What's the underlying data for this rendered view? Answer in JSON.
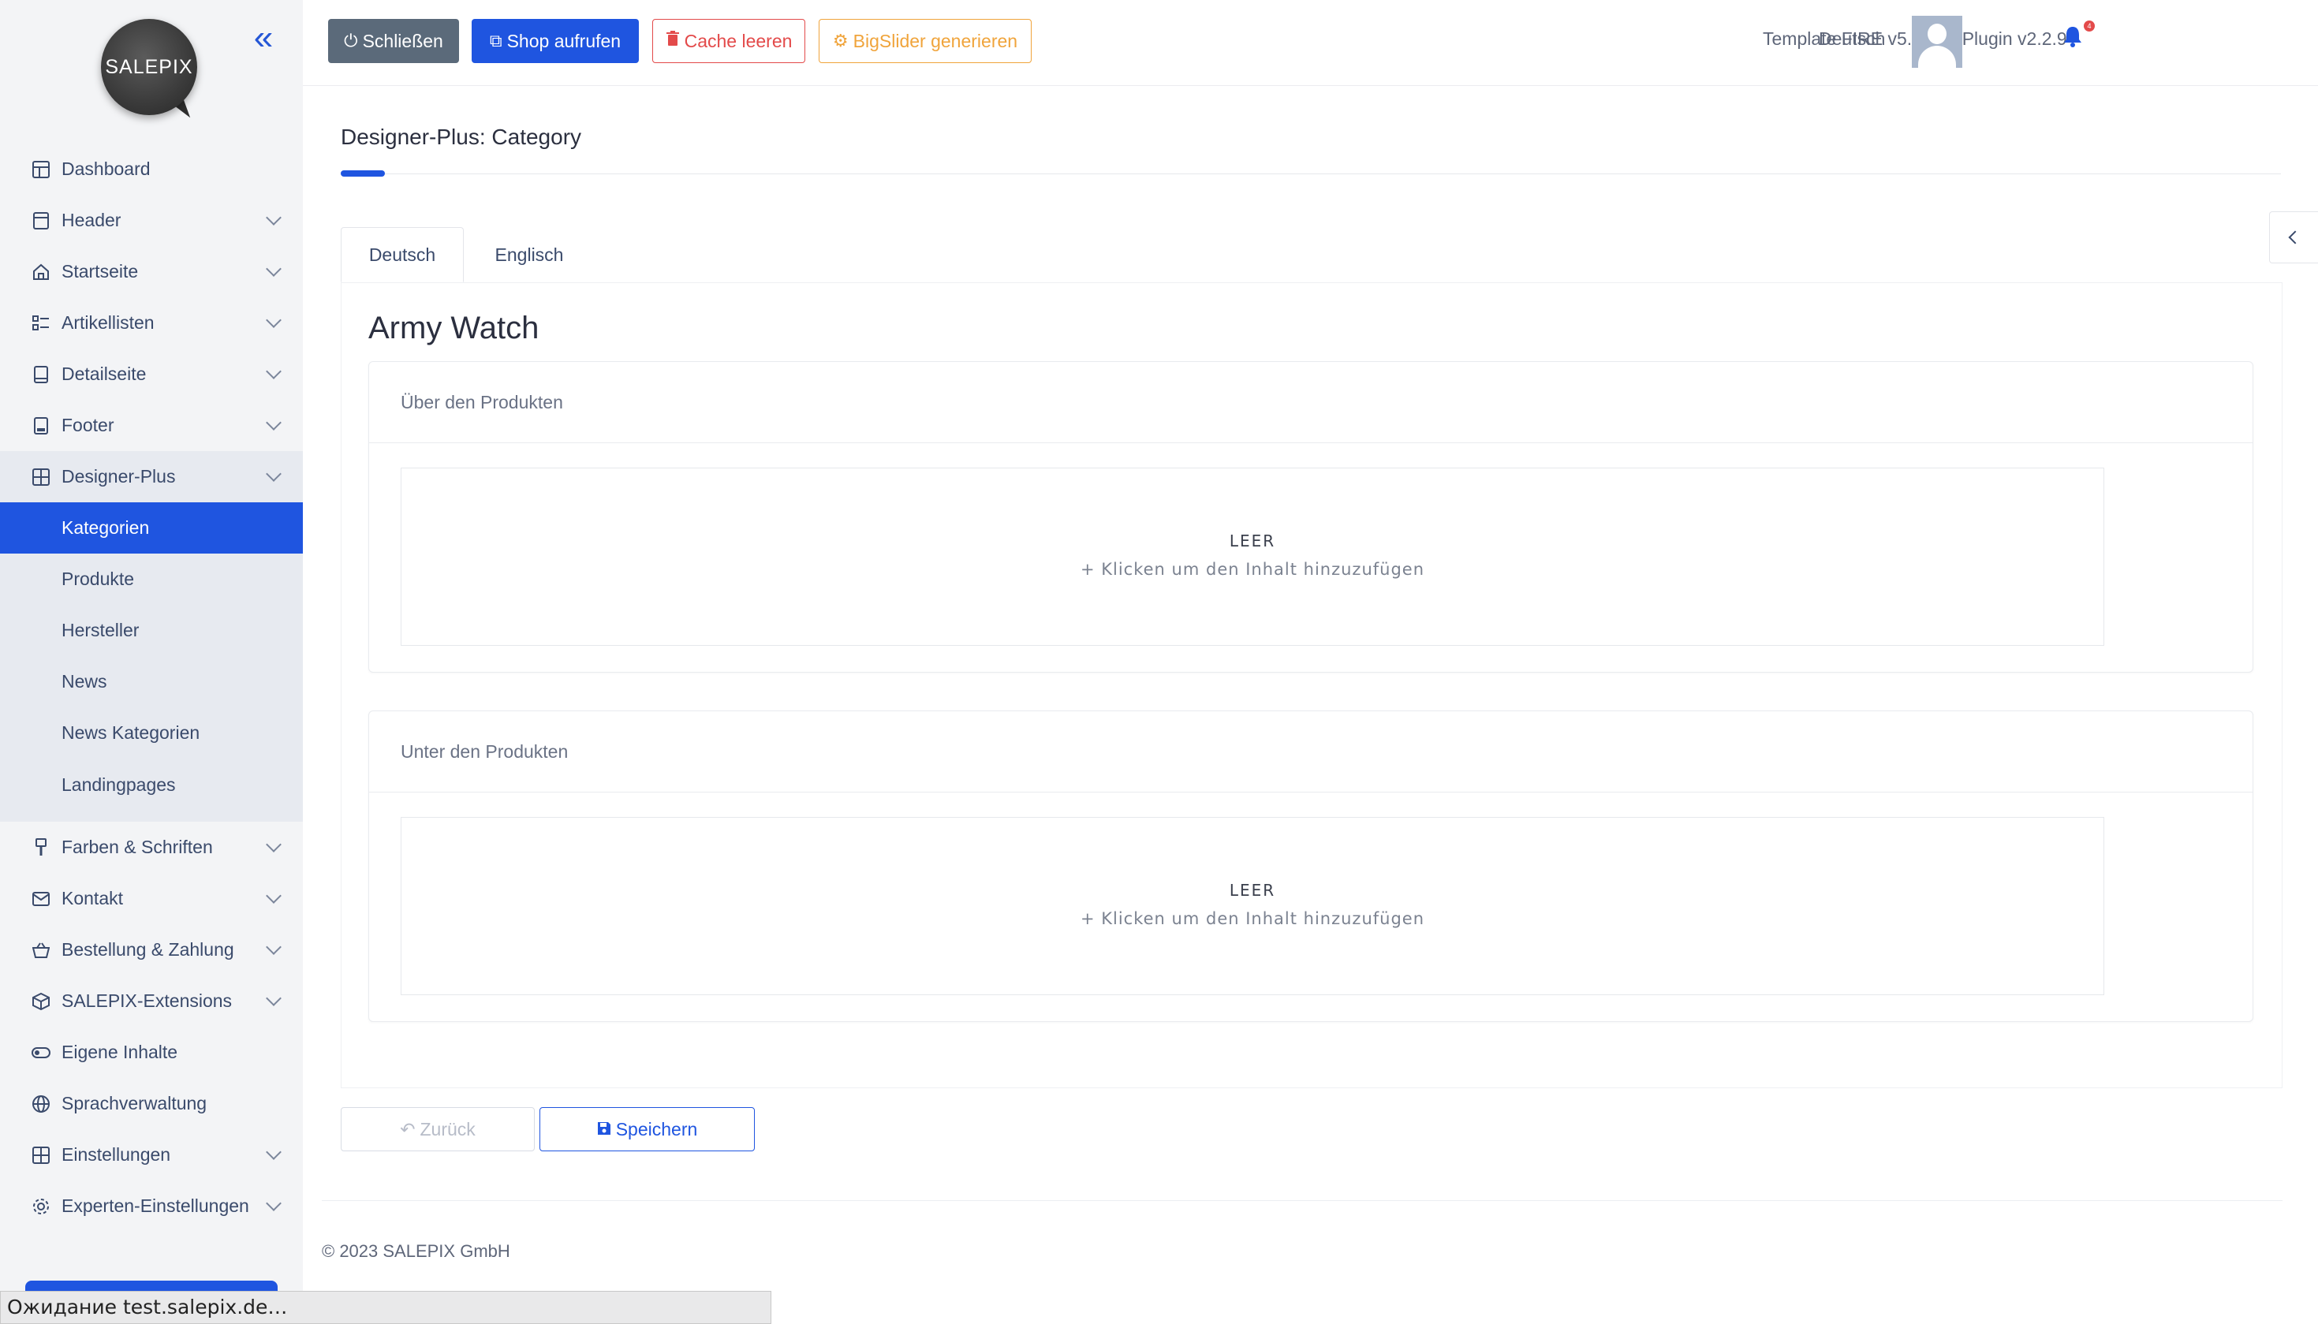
{
  "logo": {
    "text": "SALEPIX"
  },
  "sidebar": {
    "items": [
      {
        "label": "Dashboard",
        "icon": "layout-icon",
        "expandable": false
      },
      {
        "label": "Header",
        "icon": "header-icon",
        "expandable": true
      },
      {
        "label": "Startseite",
        "icon": "home-icon",
        "expandable": true
      },
      {
        "label": "Artikellisten",
        "icon": "list-icon",
        "expandable": true
      },
      {
        "label": "Detailseite",
        "icon": "tablet-icon",
        "expandable": true
      },
      {
        "label": "Footer",
        "icon": "footer-icon",
        "expandable": true
      },
      {
        "label": "Designer-Plus",
        "icon": "grid-icon",
        "expandable": true,
        "open": true
      }
    ],
    "submenu": [
      {
        "label": "Kategorien",
        "active": true
      },
      {
        "label": "Produkte"
      },
      {
        "label": "Hersteller"
      },
      {
        "label": "News"
      },
      {
        "label": "News Kategorien"
      },
      {
        "label": "Landingpages"
      }
    ],
    "items_after": [
      {
        "label": "Farben & Schriften",
        "icon": "brush-icon",
        "expandable": true
      },
      {
        "label": "Kontakt",
        "icon": "mail-icon",
        "expandable": true
      },
      {
        "label": "Bestellung & Zahlung",
        "icon": "basket-icon",
        "expandable": true
      },
      {
        "label": "SALEPIX-Extensions",
        "icon": "box-icon",
        "expandable": true
      },
      {
        "label": "Eigene Inhalte",
        "icon": "toggle-icon",
        "expandable": false
      },
      {
        "label": "Sprachverwaltung",
        "icon": "globe-icon",
        "expandable": false
      },
      {
        "label": "Einstellungen",
        "icon": "settings-grid-icon",
        "expandable": true
      },
      {
        "label": "Experten-Einstellungen",
        "icon": "gear-icon",
        "expandable": true
      }
    ]
  },
  "toolbar": {
    "close_label": "Schließen",
    "shop_label": "Shop aufrufen",
    "cache_label": "Cache leeren",
    "slider_label": "BigSlider generieren",
    "version": "Template FIRE v5.2.42 | Plugin v2.2.9",
    "notification_count": "4",
    "language": "Deutsch"
  },
  "page": {
    "title": "Designer-Plus: Category",
    "tabs": [
      {
        "label": "Deutsch",
        "active": true
      },
      {
        "label": "Englisch"
      }
    ],
    "product_name": "Army Watch",
    "sections": [
      {
        "heading": "Über den Produkten",
        "empty_label": "LEER",
        "hint": "+ Klicken um den Inhalt hinzuzufügen"
      },
      {
        "heading": "Unter den Produkten",
        "empty_label": "LEER",
        "hint": "+ Klicken um den Inhalt hinzuzufügen"
      }
    ],
    "back_label": "Zurück",
    "save_label": "Speichern"
  },
  "footer": {
    "copyright": "© 2023 SALEPIX GmbH"
  },
  "browser_status": "Ожидание test.salepix.de…",
  "colors": {
    "accent": "#1f55e0",
    "danger": "#e34a4a",
    "warning": "#f0a43b",
    "secondary": "#5b6a7a"
  }
}
